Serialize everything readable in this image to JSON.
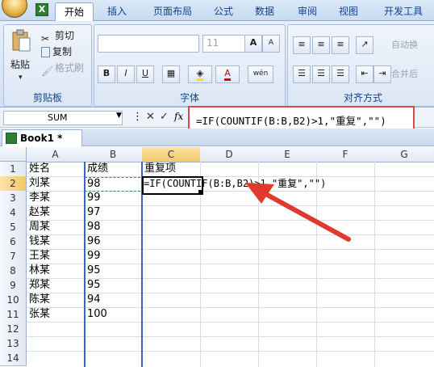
{
  "ribbon": {
    "tabs": [
      "开始",
      "插入",
      "页面布局",
      "公式",
      "数据",
      "审阅",
      "视图",
      "开发工具"
    ],
    "clipboard": {
      "paste": "粘贴",
      "cut": "剪切",
      "copy": "复制",
      "format_painter": "格式刷",
      "label": "剪贴板"
    },
    "font": {
      "size": "11",
      "label": "字体",
      "bold": "B",
      "italic": "I",
      "underline": "U",
      "grow": "A",
      "shrink": "A",
      "pinyin": "wén"
    },
    "alignment": {
      "label": "对齐方式",
      "wrap": "自动换",
      "merge": "合并后"
    }
  },
  "formula_bar": {
    "name_box": "SUM",
    "cancel": "✕",
    "enter": "✓",
    "fx": "fx",
    "formula": "=IF(COUNTIF(B:B,B2)>1,\"重复\",\"\")"
  },
  "workbook": {
    "tab": "Book1 *"
  },
  "sheet": {
    "columns": [
      "A",
      "B",
      "C",
      "D",
      "E",
      "F",
      "G"
    ],
    "rows": [
      "1",
      "2",
      "3",
      "4",
      "5",
      "6",
      "7",
      "8",
      "9",
      "10",
      "11",
      "12",
      "13",
      "14"
    ],
    "active_col": "C",
    "active_row": "2",
    "a": [
      "姓名",
      "刘某",
      "李某",
      "赵某",
      "周某",
      "钱某",
      "王某",
      "林某",
      "郑某",
      "陈某",
      "张某"
    ],
    "b": [
      "成绩",
      "98",
      "99",
      "97",
      "98",
      "96",
      "99",
      "95",
      "95",
      "94",
      "100"
    ],
    "c1": "重复项",
    "c2_editing": "=IF(COUNTIF(B:B,B2)>1,\"重复\",\"\")"
  },
  "colors": {
    "accent": "#d94a4a",
    "ribbon": "#c6dbf3",
    "selection": "#f3c86a"
  }
}
